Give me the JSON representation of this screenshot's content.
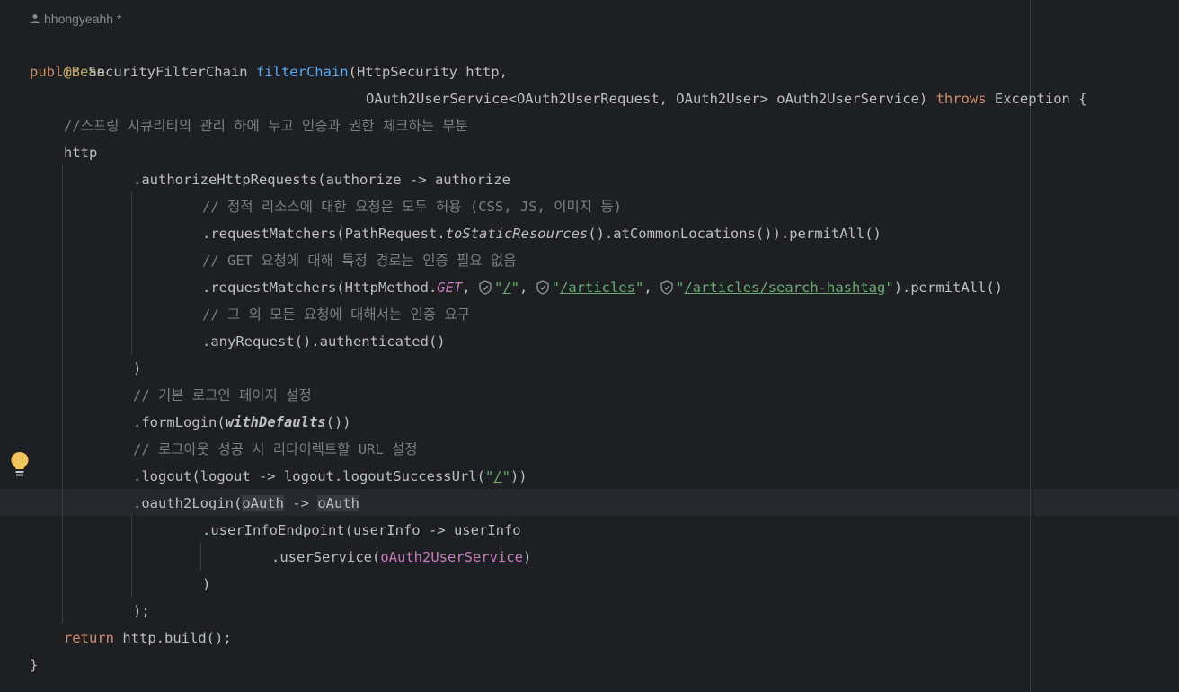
{
  "author": {
    "name": "hhongyeahh *"
  },
  "colors": {
    "background": "#1e1f22",
    "keyword": "#cf8e6d",
    "annotation": "#b3ae60",
    "method_decl": "#56a8f5",
    "comment": "#7a7e85",
    "string": "#6aab73",
    "param": "#c77dbb",
    "text": "#bcbec4"
  },
  "code": {
    "l1": "@Bean",
    "l2_public": "public",
    "l2_type": " SecurityFilterChain ",
    "l2_method": "filterChain",
    "l2_rest": "(HttpSecurity http,",
    "l3_a": "OAuth2UserService<OAuth2UserRequest, OAuth2User> oAuth2UserService) ",
    "l3_throws": "throws",
    "l3_b": " Exception {",
    "l4": "//스프링 시큐리티의 관리 하에 두고 인증과 권한 체크하는 부분",
    "l5": "http",
    "l6": ".authorizeHttpRequests(authorize -> authorize",
    "l7": "// 정적 리소스에 대한 요청은 모두 허용 (CSS, JS, 이미지 등)",
    "l8_a": ".requestMatchers(PathRequest.",
    "l8_static": "toStaticResources",
    "l8_b": "().atCommonLocations()).permitAll()",
    "l9": "// GET 요청에 대해 특정 경로는 인증 필요 없음",
    "l10_a": ".requestMatchers(HttpMethod.",
    "l10_get": "GET",
    "l10_sep1": ", ",
    "l10_q1": "\"",
    "l10_s1": "/",
    "l10_q1e": "\"",
    "l10_sep2": ", ",
    "l10_q2": "\"",
    "l10_s2": "/articles",
    "l10_q2e": "\"",
    "l10_sep3": ", ",
    "l10_q3": "\"",
    "l10_s3": "/articles/search-hashtag",
    "l10_q3e": "\"",
    "l10_b": ").permitAll()",
    "l11": "// 그 외 모든 요청에 대해서는 인증 요구",
    "l12": ".anyRequest().authenticated()",
    "l13": ")",
    "l14": "// 기본 로그인 페이지 설정",
    "l15_a": ".formLogin(",
    "l15_fn": "withDefaults",
    "l15_b": "())",
    "l16": "// 로그아웃 성공 시 리다이렉트할 URL 설정",
    "l17_a": ".logout(logout -> logout.logoutSuccessUrl(",
    "l17_q": "\"",
    "l17_s": "/",
    "l17_qe": "\"",
    "l17_b": "))",
    "l18_a": ".oauth2Login(",
    "l18_v1": "oAuth",
    "l18_arrow": " -> ",
    "l18_v2": "oAuth",
    "l19": ".userInfoEndpoint(userInfo -> userInfo",
    "l20_a": ".userService(",
    "l20_param": "oAuth2UserService",
    "l20_b": ")",
    "l21": ")",
    "l22": ");",
    "l23_return": "return",
    "l23_rest": " http.build();",
    "l24": "}"
  },
  "icons": {
    "author": "person-icon",
    "url": "globe-shield-icon",
    "intention": "lightbulb-icon"
  }
}
